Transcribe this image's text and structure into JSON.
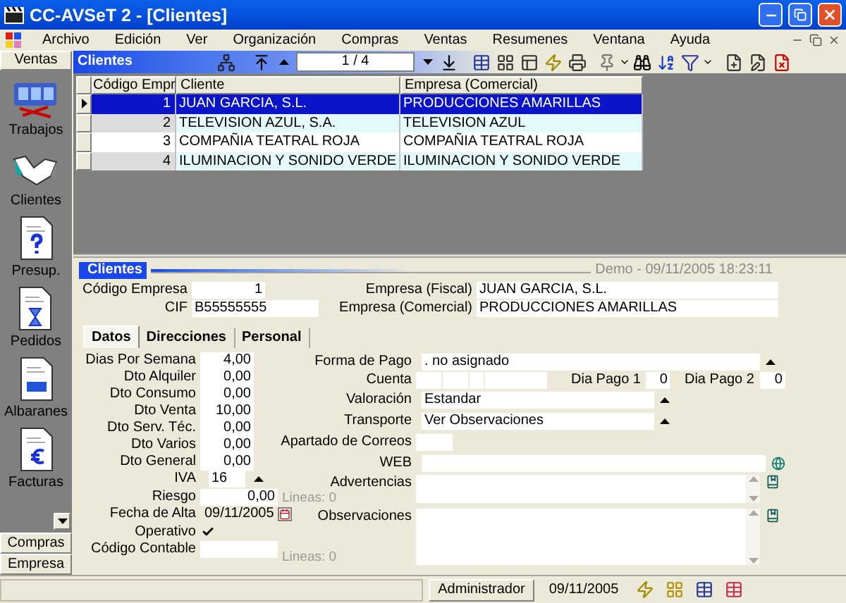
{
  "window": {
    "title": "CC-AVSeT 2 - [Clientes]"
  },
  "menu": [
    "Archivo",
    "Edición",
    "Ver",
    "Organización",
    "Compras",
    "Ventas",
    "Resumenes",
    "Ventana",
    "Ayuda"
  ],
  "sidebar": {
    "header": "Ventas",
    "items": [
      "Trabajos",
      "Clientes",
      "Presup.",
      "Pedidos",
      "Albaranes",
      "Facturas"
    ],
    "footer": [
      "Compras",
      "Empresa"
    ]
  },
  "grid_panel": {
    "title": "Clientes",
    "pager": "1 / 4"
  },
  "table": {
    "columns": [
      "Código Empr",
      "Cliente",
      "Empresa (Comercial)"
    ],
    "rows": [
      {
        "cells": [
          "1",
          "JUAN GARCIA, S.L.",
          "PRODUCCIONES AMARILLAS"
        ],
        "selected": true
      },
      {
        "cells": [
          "2",
          "TELEVISION AZUL, S.A.",
          "TELEVISION AZUL"
        ],
        "selected": false
      },
      {
        "cells": [
          "3",
          "COMPAÑIA TEATRAL ROJA",
          "COMPAÑIA TEATRAL ROJA"
        ],
        "selected": false
      },
      {
        "cells": [
          "4",
          "ILUMINACION Y SONIDO VERDE",
          "ILUMINACION Y SONIDO VERDE"
        ],
        "selected": false
      }
    ]
  },
  "detail": {
    "title": "Clientes",
    "stamp": "Demo - 09/11/2005 18:23:11",
    "header_fields": [
      {
        "label": "Código Empresa",
        "value": "1"
      },
      {
        "label": "CIF",
        "value": "B55555555"
      }
    ],
    "company_fields": [
      {
        "label": "Empresa (Fiscal)",
        "value": "JUAN GARCIA, S.L."
      },
      {
        "label": "Empresa (Comercial)",
        "value": "PRODUCCIONES AMARILLAS"
      }
    ],
    "tabs": [
      {
        "label": "Datos",
        "selected": true
      },
      {
        "label": "Direcciones",
        "selected": false
      },
      {
        "label": "Personal",
        "selected": false
      }
    ],
    "left_fields": [
      {
        "kind": "number",
        "label": "Dias Por Semana",
        "value": "4,00"
      },
      {
        "kind": "number",
        "label": "Dto Alquiler",
        "value": "0,00"
      },
      {
        "kind": "number",
        "label": "Dto Consumo",
        "value": "0,00"
      },
      {
        "kind": "number",
        "label": "Dto Venta",
        "value": "10,00"
      },
      {
        "kind": "number",
        "label": "Dto Serv. Téc.",
        "value": "0,00"
      },
      {
        "kind": "number",
        "label": "Dto Varios",
        "value": "0,00"
      },
      {
        "kind": "number",
        "label": "Dto General",
        "value": "0,00"
      },
      {
        "kind": "combo",
        "label": "IVA",
        "value": "16"
      },
      {
        "kind": "wide",
        "label": "Riesgo",
        "value": "0,00"
      },
      {
        "kind": "date",
        "label": "Fecha de Alta",
        "value": "09/11/2005"
      },
      {
        "kind": "check",
        "label": "Operativo",
        "checked": true
      },
      {
        "kind": "wide",
        "label": "Código Contable"
      }
    ],
    "right_fields": [
      {
        "kind": "combo_wide",
        "label": "Forma de Pago",
        "value": ". no asignado"
      },
      {
        "kind": "account",
        "label": "Cuenta",
        "day1_label": "Dia Pago 1",
        "day1": "0",
        "day2_label": "Dia Pago 2",
        "day2": "0"
      },
      {
        "kind": "combo",
        "label": "Valoración",
        "value": "Estandar"
      },
      {
        "kind": "combo",
        "label": "Transporte",
        "value": "Ver Observaciones"
      },
      {
        "kind": "short",
        "label": "Apartado de Correos"
      },
      {
        "kind": "web",
        "label": "WEB"
      },
      {
        "kind": "memo",
        "label": "Advertencias",
        "lines": "Lineas: 0"
      },
      {
        "kind": "memo_tall",
        "label": "Observaciones",
        "lines": "Lineas: 0"
      }
    ]
  },
  "status_bar": {
    "user": "Administrador",
    "date": "09/11/2005"
  }
}
